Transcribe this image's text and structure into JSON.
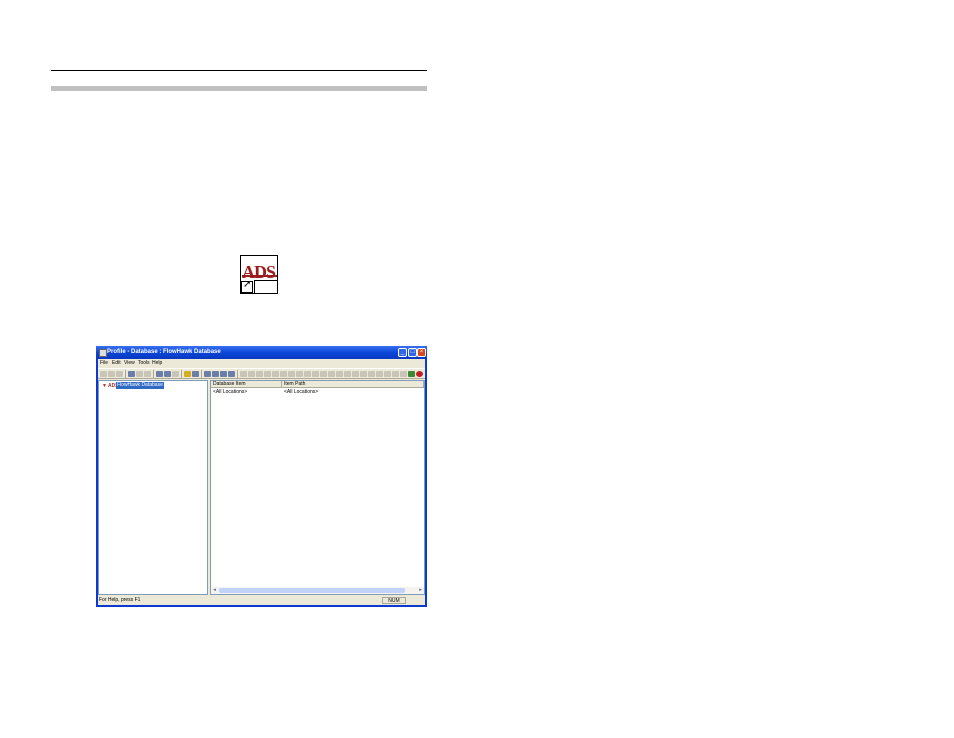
{
  "desktop_icon": {
    "text": "ADS",
    "name": "ads-shortcut-icon"
  },
  "window": {
    "title": "Profile - Database : FlowHawk Database",
    "controls": [
      "minimize",
      "maximize",
      "close"
    ]
  },
  "menu": {
    "file": "File",
    "edit": "Edit",
    "view": "View",
    "tools": "Tools",
    "help": "Help"
  },
  "tree": {
    "root_icon": "ADS",
    "root_label": "FlowHawk Database"
  },
  "list": {
    "columns": [
      "Database Item",
      "Item Path"
    ],
    "rows": [
      {
        "item": "<All Locations>",
        "path": "<All Locations>"
      }
    ]
  },
  "status": {
    "text": "For Help, press F1",
    "num": "NUM"
  },
  "colors": {
    "title_bar": "#0a46d8",
    "selection": "#316ac5",
    "ads_red": "#9b1c1c"
  }
}
